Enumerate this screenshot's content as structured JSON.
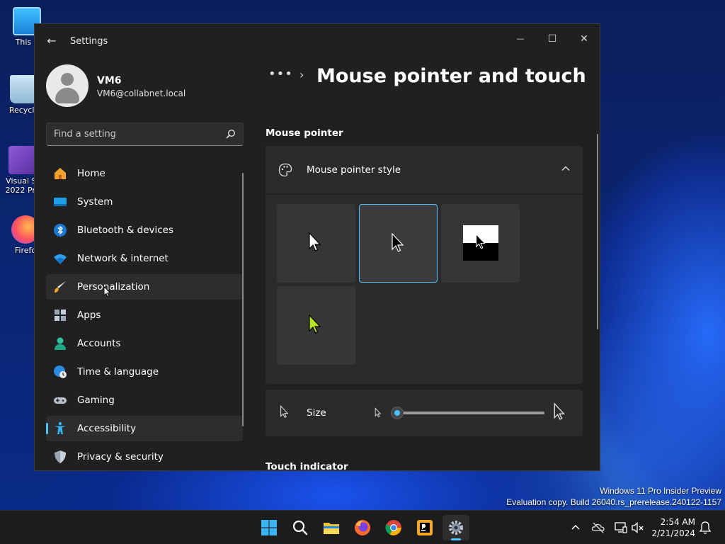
{
  "desktop": {
    "icons": [
      {
        "label": "This P"
      },
      {
        "label": "Recycle"
      },
      {
        "label": "Visual St"
      },
      {
        "label": "2022 Pre"
      },
      {
        "label": "Firefo"
      }
    ],
    "watermark_line1": "Windows 11 Pro Insider Preview",
    "watermark_line2": "Evaluation copy. Build 26040.rs_prerelease.240122-1157"
  },
  "window": {
    "title": "Settings",
    "back_glyph": "←",
    "minimize_glyph": "—",
    "maximize_glyph": "☐",
    "close_glyph": "✕"
  },
  "user": {
    "name": "VM6",
    "email": "VM6@collabnet.local"
  },
  "search": {
    "placeholder": "Find a setting"
  },
  "nav": {
    "items": [
      {
        "label": "Home",
        "icon": "home-icon"
      },
      {
        "label": "System",
        "icon": "system-icon"
      },
      {
        "label": "Bluetooth & devices",
        "icon": "bluetooth-icon"
      },
      {
        "label": "Network & internet",
        "icon": "wifi-icon"
      },
      {
        "label": "Personalization",
        "icon": "brush-icon"
      },
      {
        "label": "Apps",
        "icon": "apps-icon"
      },
      {
        "label": "Accounts",
        "icon": "accounts-icon"
      },
      {
        "label": "Time & language",
        "icon": "globe-clock-icon"
      },
      {
        "label": "Gaming",
        "icon": "gamepad-icon"
      },
      {
        "label": "Accessibility",
        "icon": "accessibility-icon"
      },
      {
        "label": "Privacy & security",
        "icon": "shield-icon"
      }
    ],
    "selected": "Accessibility",
    "hovered": "Personalization"
  },
  "main": {
    "breadcrumb_dots": "•••",
    "breadcrumb_sep": "›",
    "page_title": "Mouse pointer and touch",
    "section_mouse_pointer": "Mouse pointer",
    "pointer_style_label": "Mouse pointer style",
    "pointer_styles": [
      "white",
      "black",
      "inverted",
      "custom"
    ],
    "pointer_style_selected": "black",
    "custom_color": "#b5e61d",
    "size_label": "Size",
    "size_value": 0,
    "size_max": 14,
    "section_touch_indicator": "Touch indicator"
  },
  "taskbar": {
    "apps": [
      "start",
      "search",
      "file-explorer",
      "firefox",
      "chrome",
      "pycharm",
      "settings"
    ],
    "active_app": "settings",
    "time": "2:54 AM",
    "date": "2/21/2024"
  },
  "colors": {
    "accent": "#4cc2ff",
    "window_bg": "#202020",
    "card_bg": "#2b2b2b"
  }
}
